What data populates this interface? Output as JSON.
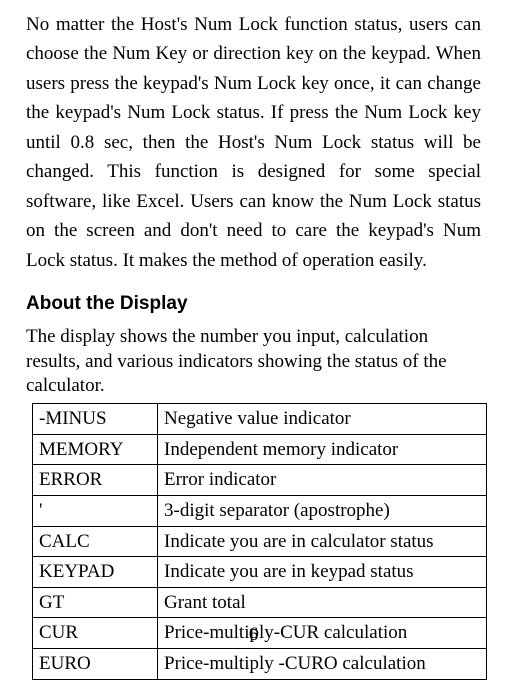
{
  "paragraph": "No matter the Host's Num Lock function status, users can choose the Num Key or direction key on the keypad. When users press the keypad's Num Lock key once, it can change the keypad's Num Lock status. If press the Num Lock key until 0.8 sec, then the Host's Num Lock status will be changed. This function is designed for some special software, like Excel. Users can know the Num Lock status on the screen and don't need to care the keypad's Num Lock status. It makes the method of operation easily.",
  "heading": "About the Display",
  "intro": "The display shows the number you input, calculation results, and various indicators showing the status of the calculator.",
  "rows": [
    {
      "key": "-MINUS",
      "desc": "Negative value indicator"
    },
    {
      "key": "MEMORY",
      "desc": "Independent memory indicator"
    },
    {
      "key": "ERROR",
      "desc": "Error indicator"
    },
    {
      "key": "'",
      "desc": "3-digit separator (apostrophe)"
    },
    {
      "key": "CALC",
      "desc": "Indicate you are in calculator status"
    },
    {
      "key": "KEYPAD",
      "desc": "Indicate you are in keypad status"
    },
    {
      "key": "GT",
      "desc": "Grant total"
    },
    {
      "key": "CUR",
      "desc": "Price-multiply-CUR calculation"
    },
    {
      "key": "EURO",
      "desc": "Price-multiply -CURO calculation"
    }
  ],
  "page_number": "6"
}
